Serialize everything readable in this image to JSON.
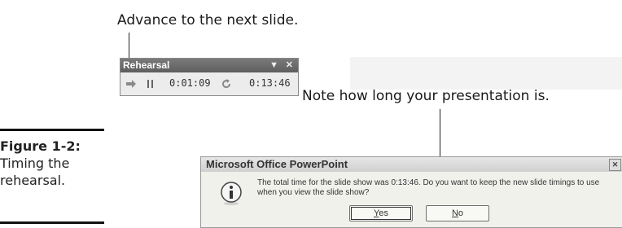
{
  "callouts": {
    "top": "Advance to the next slide.",
    "right": "Note how long your presentation is."
  },
  "figure": {
    "label": "Figure 1-2:",
    "caption_lines": [
      "Timing the",
      "rehearsal."
    ]
  },
  "rehearsal_toolbar": {
    "title": "Rehearsal",
    "slide_time": "0:01:09",
    "total_time": "0:13:46",
    "icons": [
      "next-arrow-icon",
      "pause-icon",
      "repeat-icon",
      "dropdown-icon",
      "close-icon"
    ]
  },
  "dialog": {
    "title": "Microsoft Office PowerPoint",
    "message": "The total time for the slide show was 0:13:46. Do you want to keep the new slide timings to use when you view the slide show?",
    "yes_hotkey": "Y",
    "yes_rest": "es",
    "no_hotkey": "N",
    "no_rest": "o",
    "icon": "info-icon"
  }
}
